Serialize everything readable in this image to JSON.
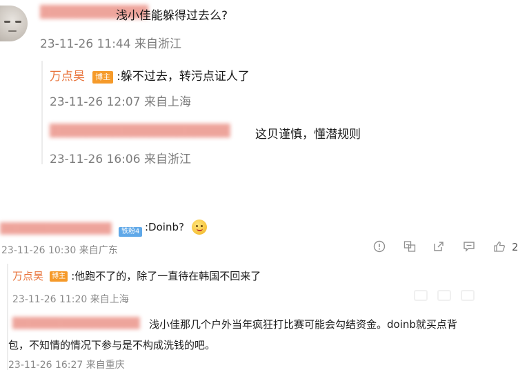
{
  "comment1": {
    "text": "浅小佳能躲得过去么?",
    "meta": "23-11-26 11:44 来自浙江",
    "replies": [
      {
        "author": "万点昊",
        "badge": "博主",
        "text": ":躲不过去，转污点证人了",
        "meta": "23-11-26 12:07 来自上海"
      },
      {
        "text": "这贝谨慎，懂潜规则",
        "meta": "23-11-26 16:06 来自浙江"
      }
    ]
  },
  "comment2": {
    "fan_badge": "铁粉4",
    "text": ":Doinb?",
    "meta": "23-11-26 10:30 来自广东",
    "actions": [
      "info-icon",
      "translate-icon",
      "share-icon",
      "comment-icon",
      "like-icon"
    ],
    "like_count": "2",
    "replies": [
      {
        "author": "万点昊",
        "badge": "博主",
        "text": ":他跑不了的，除了一直待在韩国不回来了",
        "meta": "23-11-26 11:20 来自上海"
      },
      {
        "text_line1": "浅小佳那几个户外当年疯狂打比赛可能会勾结资金。doinb就买点背",
        "text_line2": "包，不知情的情况下参与是不构成洗钱的吧。",
        "meta": "23-11-26 16:27 来自重庆"
      }
    ]
  },
  "colors": {
    "name": "#e8743c",
    "badge": "#f59a2a",
    "fan_badge": "#5fa8e8",
    "meta": "#7d7d7d"
  }
}
